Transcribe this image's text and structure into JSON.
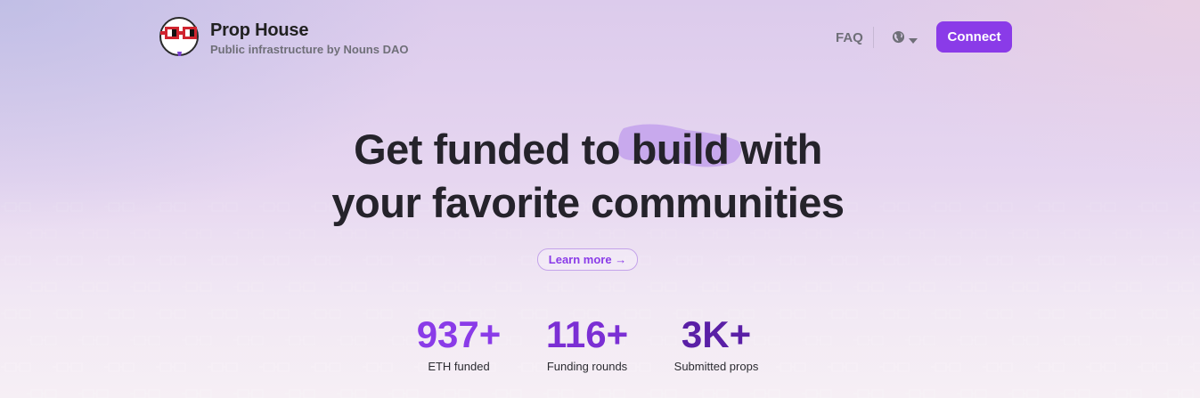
{
  "brand": {
    "title": "Prop House",
    "subtitle": "Public infrastructure by Nouns DAO",
    "logo_icon": "nouns-glasses-logo-icon"
  },
  "nav": {
    "faq_label": "FAQ",
    "language_icon": "globe-icon",
    "connect_label": "Connect"
  },
  "hero": {
    "line1_before": "Get funded to ",
    "line1_highlight": "build",
    "line1_after": " with",
    "line2": "your favorite communities",
    "learn_more_label": "Learn more →"
  },
  "stats": [
    {
      "value": "937+",
      "label": "ETH funded",
      "color": "#8a3be8"
    },
    {
      "value": "116+",
      "label": "Funding rounds",
      "color": "#7b2fd4"
    },
    {
      "value": "3K+",
      "label": "Submitted props",
      "color": "#5a1fa6"
    }
  ],
  "colors": {
    "accent": "#8a3be8",
    "highlight": "#c3a1ec",
    "text": "#25232b",
    "muted": "#6f6f78"
  }
}
